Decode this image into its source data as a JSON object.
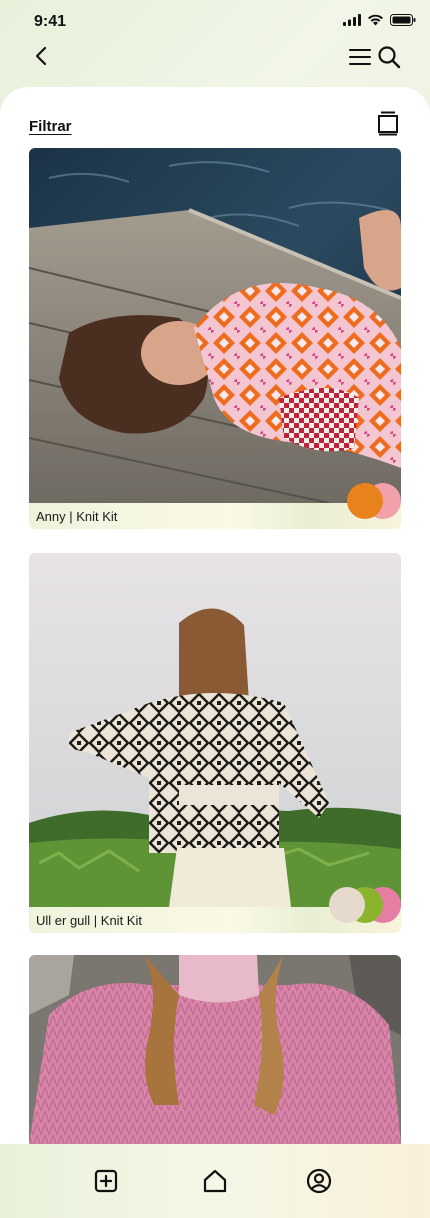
{
  "status_bar": {
    "time": "9:41"
  },
  "toolbar": {
    "filter_label": "Filtrar"
  },
  "products": [
    {
      "label": "Anny | Knit Kit",
      "swatches": [
        "#e8821d",
        "#f2a1ab"
      ]
    },
    {
      "label": "Ull er gull | Knit Kit",
      "swatches": [
        "#e6dace",
        "#8cb32c",
        "#e67da3"
      ]
    },
    {
      "label": ""
    }
  ],
  "colors": {
    "accent_bg": "#eef3dc",
    "text": "#111111"
  },
  "tab_bar": {
    "items": [
      "add-icon",
      "home-icon",
      "profile-icon"
    ]
  }
}
